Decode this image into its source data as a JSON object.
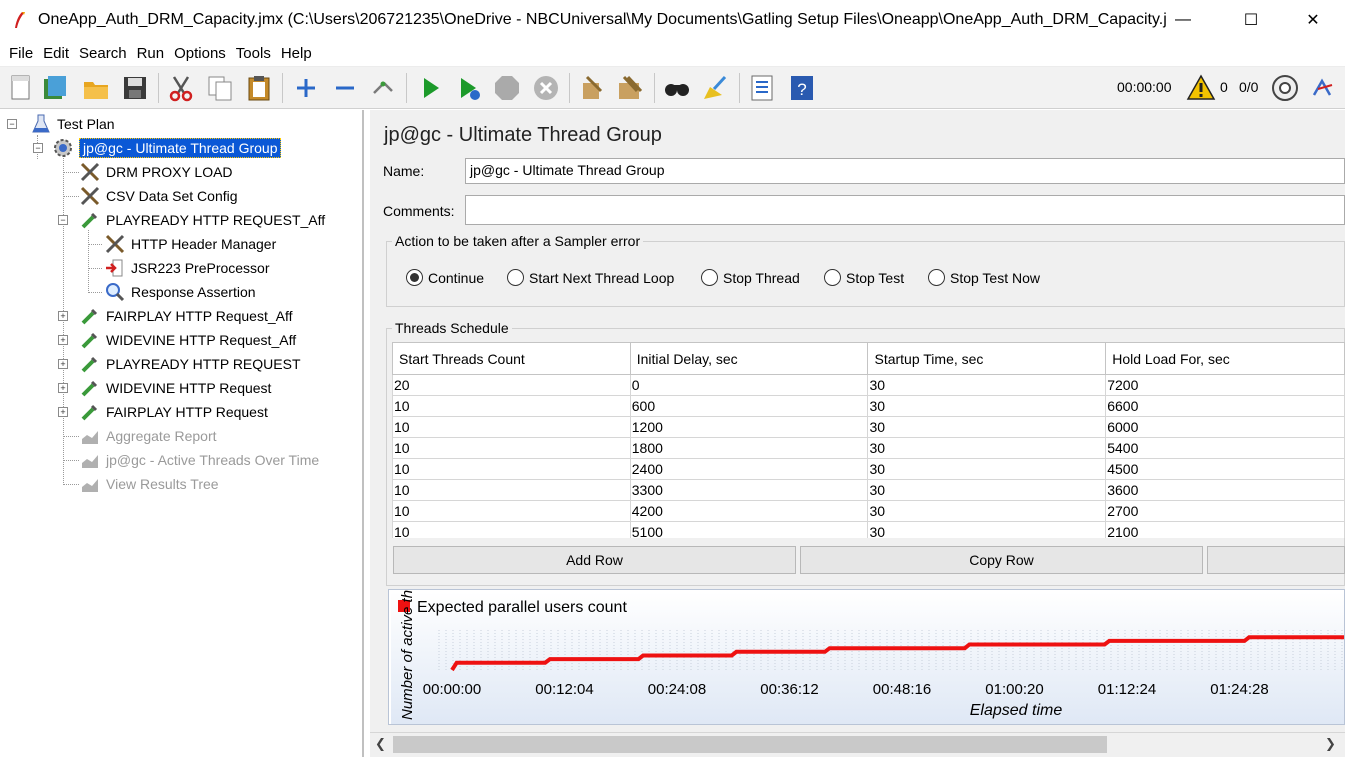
{
  "window": {
    "title": "OneApp_Auth_DRM_Capacity.jmx (C:\\Users\\206721235\\OneDrive - NBCUniversal\\My Documents\\Gatling Setup Files\\Oneapp\\OneApp_Auth_DRM_Capacity.j...",
    "minimize": "—",
    "maximize": "☐",
    "close": "✕"
  },
  "menu": [
    "File",
    "Edit",
    "Search",
    "Run",
    "Options",
    "Tools",
    "Help"
  ],
  "toolbar": {
    "timer": "00:00:00",
    "warnings": "0",
    "threads": "0/0"
  },
  "tree": {
    "root": "Test Plan",
    "thread_group": "jp@gc - Ultimate Thread Group",
    "items": [
      "DRM PROXY LOAD",
      "CSV Data Set Config",
      "PLAYREADY HTTP REQUEST_Aff",
      "HTTP Header Manager",
      "JSR223 PreProcessor",
      "Response Assertion",
      "FAIRPLAY HTTP Request_Aff",
      "WIDEVINE HTTP Request_Aff",
      "PLAYREADY HTTP REQUEST",
      "WIDEVINE HTTP Request",
      "FAIRPLAY HTTP Request",
      "Aggregate Report",
      "jp@gc - Active Threads Over Time",
      "View Results Tree"
    ]
  },
  "panel": {
    "title": "jp@gc - Ultimate Thread Group",
    "name_label": "Name:",
    "name_value": "jp@gc - Ultimate Thread Group",
    "comments_label": "Comments:",
    "comments_value": "",
    "action_group_title": "Action to be taken after a Sampler error",
    "actions": [
      "Continue",
      "Start Next Thread Loop",
      "Stop Thread",
      "Stop Test",
      "Stop Test Now"
    ],
    "selected_action": "Continue",
    "schedule_title": "Threads Schedule",
    "columns": [
      "Start Threads Count",
      "Initial Delay, sec",
      "Startup Time, sec",
      "Hold Load For, sec"
    ],
    "rows": [
      [
        "20",
        "0",
        "30",
        "7200"
      ],
      [
        "10",
        "600",
        "30",
        "6600"
      ],
      [
        "10",
        "1200",
        "30",
        "6000"
      ],
      [
        "10",
        "1800",
        "30",
        "5400"
      ],
      [
        "10",
        "2400",
        "30",
        "4500"
      ],
      [
        "10",
        "3300",
        "30",
        "3600"
      ],
      [
        "10",
        "4200",
        "30",
        "2700"
      ],
      [
        "10",
        "5100",
        "30",
        "2100"
      ]
    ],
    "buttons": [
      "Add Row",
      "Copy Row"
    ]
  },
  "chart_data": {
    "type": "line",
    "legend": "Expected parallel users count",
    "xlabel": "Elapsed time",
    "ylabel": "Number of active threads",
    "x_ticks": [
      "00:00:00",
      "00:12:04",
      "00:24:08",
      "00:36:12",
      "00:48:16",
      "01:00:20",
      "01:12:24",
      "01:24:28"
    ],
    "color": "#ee1111"
  }
}
